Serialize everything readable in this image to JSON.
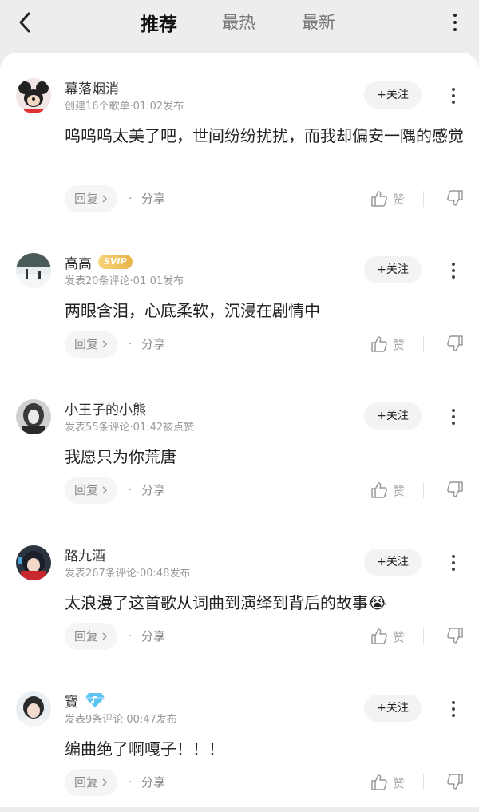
{
  "header": {
    "tabs": [
      "推荐",
      "最热",
      "最新"
    ],
    "active_tab": 0
  },
  "comment_actions": {
    "follow_label": "+关注",
    "reply_label": "回复",
    "share_label": "分享",
    "like_label": "赞"
  },
  "comments": [
    {
      "username": "幕落烟消",
      "badge": "",
      "meta": "创建16个歌单·01:02发布",
      "text": "呜呜呜太美了吧，世间纷纷扰扰，而我却偏安一隅的感觉",
      "avatar": "mickey-avatar"
    },
    {
      "username": "高高",
      "badge": "SVIP",
      "meta": "发表20条评论·01:01发布",
      "text": "两眼含泪，心底柔软，沉浸在剧情中",
      "avatar": "snow-scene-avatar"
    },
    {
      "username": "小王子的小熊",
      "badge": "",
      "meta": "发表55条评论·01:42被点赞",
      "text": "我愿只为你荒唐",
      "avatar": "dark-portrait-avatar"
    },
    {
      "username": "路九酒",
      "badge": "",
      "meta": "发表267条评论·00:48发布",
      "text": "太浪漫了这首歌从词曲到演绎到背后的故事😭",
      "avatar": "anime-girl-avatar"
    },
    {
      "username": "寳",
      "badge": "diamond-music-badge",
      "meta": "发表9条评论·00:47发布",
      "text": "编曲绝了啊嘎子！！！",
      "avatar": "girl-avatar"
    }
  ]
}
